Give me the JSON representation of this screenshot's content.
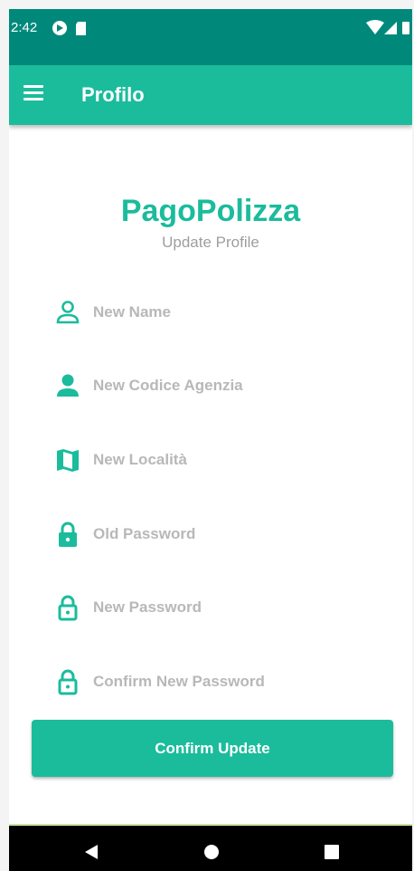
{
  "status_bar": {
    "time": "2:42"
  },
  "app_bar": {
    "title": "Profilo"
  },
  "brand": {
    "title": "PagoPolizza",
    "subtitle": "Update Profile"
  },
  "fields": [
    {
      "placeholder": "New Name",
      "icon": "person-outline-icon"
    },
    {
      "placeholder": "New Codice Agenzia",
      "icon": "person-icon"
    },
    {
      "placeholder": "New Località",
      "icon": "map-icon"
    },
    {
      "placeholder": "Old Password",
      "icon": "lock-icon"
    },
    {
      "placeholder": "New Password",
      "icon": "lock-outline-icon"
    },
    {
      "placeholder": "Confirm New Password",
      "icon": "lock-outline-icon"
    }
  ],
  "actions": {
    "confirm_label": "Confirm Update"
  },
  "colors": {
    "accent": "#1abc9c",
    "status_bar": "#00897b",
    "placeholder": "#b8b8b8"
  }
}
